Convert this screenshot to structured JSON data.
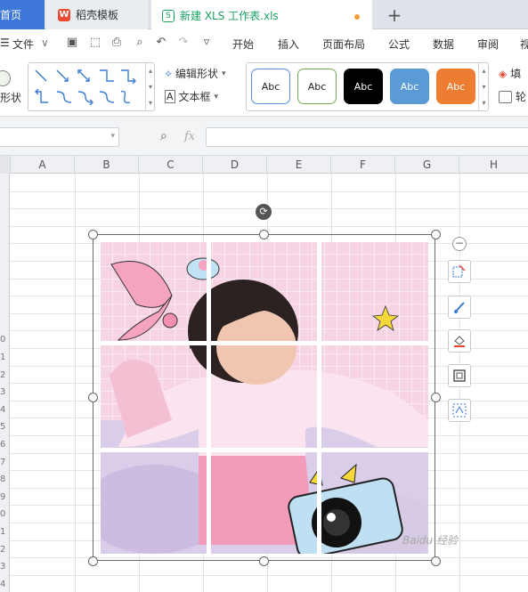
{
  "tabs": {
    "home": "首页",
    "template": "稻壳模板",
    "doc": "新建 XLS 工作表.xls",
    "add": "+"
  },
  "menu": {
    "file": "文件",
    "items": [
      "开始",
      "插入",
      "页面布局",
      "公式",
      "数据",
      "审阅",
      "视"
    ]
  },
  "ribbon": {
    "edit_shape": "编辑形状",
    "text_box": "文本框",
    "shape_label": "形状",
    "fill": "填",
    "outline": "轮",
    "styles": [
      {
        "label": "Abc",
        "bg": "#ffffff",
        "border": "#5b8ed6",
        "fg": "#222222"
      },
      {
        "label": "Abc",
        "bg": "#ffffff",
        "border": "#6fae52",
        "fg": "#222222"
      },
      {
        "label": "Abc",
        "bg": "#000000",
        "border": "#000000",
        "fg": "#ffffff"
      },
      {
        "label": "Abc",
        "bg": "#5b9bd5",
        "border": "#5b9bd5",
        "fg": "#ffffff"
      },
      {
        "label": "Abc",
        "bg": "#ed7d31",
        "border": "#ed7d31",
        "fg": "#ffffff"
      }
    ]
  },
  "formula": {
    "fx": "fx"
  },
  "columns": [
    "A",
    "B",
    "C",
    "D",
    "E",
    "F",
    "G",
    "H"
  ],
  "rows": [
    "",
    "",
    "",
    "",
    "",
    "",
    "",
    "",
    "",
    "0",
    "1",
    "2",
    "3",
    "4",
    "5",
    "6",
    "7",
    "8",
    "9",
    "0",
    "1",
    "2",
    "3",
    "4"
  ],
  "watermark": "Baidu 经验",
  "colors": {
    "accent": "#3d78d8",
    "doc_green": "#1aa260",
    "modified_dot": "#f39b3a"
  }
}
